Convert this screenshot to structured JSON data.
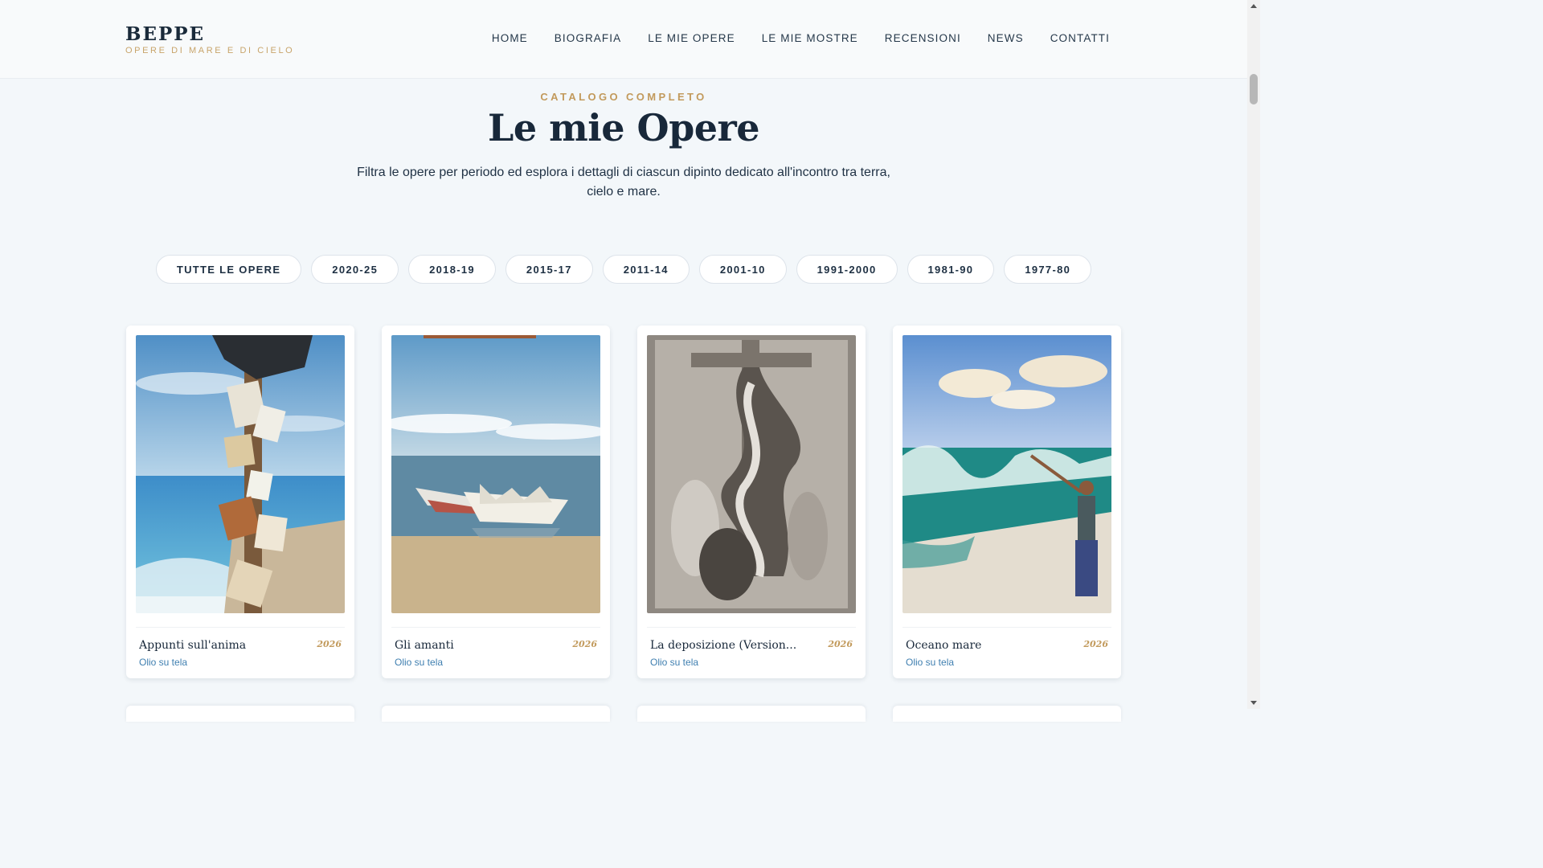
{
  "brand": {
    "name": "BEPPE",
    "tagline": "OPERE DI MARE E DI CIELO"
  },
  "nav": {
    "items": [
      {
        "label": "HOME"
      },
      {
        "label": "BIOGRAFIA"
      },
      {
        "label": "LE MIE OPERE"
      },
      {
        "label": "LE MIE MOSTRE"
      },
      {
        "label": "RECENSIONI"
      },
      {
        "label": "NEWS"
      },
      {
        "label": "CONTATTI"
      }
    ]
  },
  "hero": {
    "eyebrow": "CATALOGO COMPLETO",
    "title": "Le mie Opere",
    "subtitle": "Filtra le opere per periodo ed esplora i dettagli di ciascun dipinto dedicato all'incontro tra terra, cielo e mare."
  },
  "filters": [
    {
      "label": "TUTTE LE OPERE"
    },
    {
      "label": "2020-25"
    },
    {
      "label": "2018-19"
    },
    {
      "label": "2015-17"
    },
    {
      "label": "2011-14"
    },
    {
      "label": "2001-10"
    },
    {
      "label": "1991-2000"
    },
    {
      "label": "1981-90"
    },
    {
      "label": "1977-80"
    }
  ],
  "artworks": [
    {
      "title": "Appunti sull'anima",
      "year": "2026",
      "medium": "Olio su tela"
    },
    {
      "title": "Gli amanti",
      "year": "2026",
      "medium": "Olio su tela"
    },
    {
      "title": "La deposizione (Version...",
      "year": "2026",
      "medium": "Olio su tela"
    },
    {
      "title": "Oceano mare",
      "year": "2026",
      "medium": "Olio su tela"
    }
  ],
  "colors": {
    "accent_gold": "#c29a5c",
    "text_dark": "#18283a",
    "medium_blue": "#3f7fb0",
    "page_bg": "#f3f7fa"
  }
}
